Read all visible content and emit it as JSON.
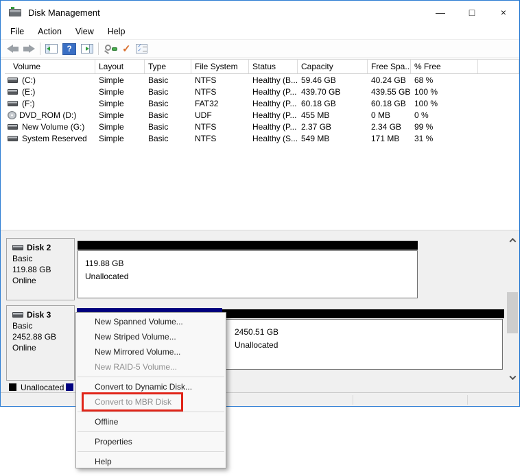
{
  "window": {
    "title": "Disk Management"
  },
  "icons": {
    "minimize": "—",
    "maximize": "□",
    "close": "×",
    "help_glyph": "?",
    "check_glyph": "✓"
  },
  "menu_bar": {
    "items": [
      {
        "label": "File"
      },
      {
        "label": "Action"
      },
      {
        "label": "View"
      },
      {
        "label": "Help"
      }
    ]
  },
  "toolbar": {
    "buttons": [
      "back",
      "forward",
      "show-console-tree",
      "help",
      "show-action-pane",
      "zoom",
      "commit-check",
      "checklist"
    ]
  },
  "volume_table": {
    "headers": [
      "Volume",
      "Layout",
      "Type",
      "File System",
      "Status",
      "Capacity",
      "Free Spa...",
      "% Free"
    ],
    "rows": [
      {
        "icon": "drive",
        "volume": "(C:)",
        "layout": "Simple",
        "type": "Basic",
        "file_system": "NTFS",
        "status": "Healthy (B...",
        "capacity": "59.46 GB",
        "free_space": "40.24 GB",
        "percent_free": "68 %"
      },
      {
        "icon": "drive",
        "volume": "(E:)",
        "layout": "Simple",
        "type": "Basic",
        "file_system": "NTFS",
        "status": "Healthy (P...",
        "capacity": "439.70 GB",
        "free_space": "439.55 GB",
        "percent_free": "100 %"
      },
      {
        "icon": "drive",
        "volume": "(F:)",
        "layout": "Simple",
        "type": "Basic",
        "file_system": "FAT32",
        "status": "Healthy (P...",
        "capacity": "60.18 GB",
        "free_space": "60.18 GB",
        "percent_free": "100 %"
      },
      {
        "icon": "dvd",
        "volume": "DVD_ROM (D:)",
        "layout": "Simple",
        "type": "Basic",
        "file_system": "UDF",
        "status": "Healthy (P...",
        "capacity": "455 MB",
        "free_space": "0 MB",
        "percent_free": "0 %"
      },
      {
        "icon": "drive",
        "volume": "New Volume (G:)",
        "layout": "Simple",
        "type": "Basic",
        "file_system": "NTFS",
        "status": "Healthy (P...",
        "capacity": "2.37 GB",
        "free_space": "2.34 GB",
        "percent_free": "99 %"
      },
      {
        "icon": "drive",
        "volume": "System Reserved",
        "layout": "Simple",
        "type": "Basic",
        "file_system": "NTFS",
        "status": "Healthy (S...",
        "capacity": "549 MB",
        "free_space": "171 MB",
        "percent_free": "31 %"
      }
    ]
  },
  "disks": [
    {
      "name": "Disk 2",
      "type": "Basic",
      "size": "119.88 GB",
      "status": "Online",
      "region": {
        "size": "119.88 GB",
        "label": "Unallocated"
      }
    },
    {
      "name": "Disk 3",
      "type": "Basic",
      "size": "2452.88 GB",
      "status": "Online",
      "region": {
        "size": "2450.51 GB",
        "label": "Unallocated"
      }
    }
  ],
  "legend": {
    "unallocated": "Unallocated"
  },
  "context_menu": {
    "items": [
      {
        "label": "New Spanned Volume...",
        "enabled": true
      },
      {
        "label": "New Striped Volume...",
        "enabled": true
      },
      {
        "label": "New Mirrored Volume...",
        "enabled": true
      },
      {
        "label": "New RAID-5 Volume...",
        "enabled": false
      },
      {
        "label": "Convert to Dynamic Disk...",
        "enabled": true
      },
      {
        "label": "Convert to MBR Disk",
        "enabled": false,
        "annotated": true
      },
      {
        "label": "Offline",
        "enabled": true
      },
      {
        "label": "Properties",
        "enabled": true
      },
      {
        "label": "Help",
        "enabled": true
      }
    ]
  },
  "colors": {
    "window_border": "#2b7cd3",
    "selection_navy": "#000080",
    "unallocated_black": "#000000",
    "annotation_red": "#e02418",
    "disabled_text": "#8f8f8f"
  }
}
